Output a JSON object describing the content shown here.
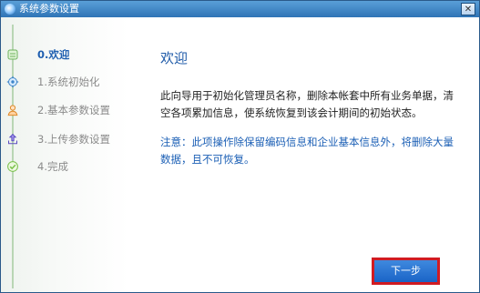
{
  "window": {
    "title": "系统参数设置",
    "close_label": "✕"
  },
  "sidebar": {
    "steps": [
      {
        "label": "0.欢迎",
        "icon": "welcome-doc-icon"
      },
      {
        "label": "1.系统初始化",
        "icon": "gear-icon"
      },
      {
        "label": "2.基本参数设置",
        "icon": "user-icon"
      },
      {
        "label": "3.上传参数设置",
        "icon": "upload-icon"
      },
      {
        "label": "4.完成",
        "icon": "check-icon"
      }
    ]
  },
  "main": {
    "title": "欢迎",
    "description": "此向导用于初始化管理员名称，删除本帐套中所有业务单据，清空各项累加信息，使系统恢复到该会计期间的初始状态。",
    "note": "注意：此项操作除保留编码信息和企业基本信息外，将删除大量数据，且不可恢复。",
    "next_button": "下一步"
  }
}
